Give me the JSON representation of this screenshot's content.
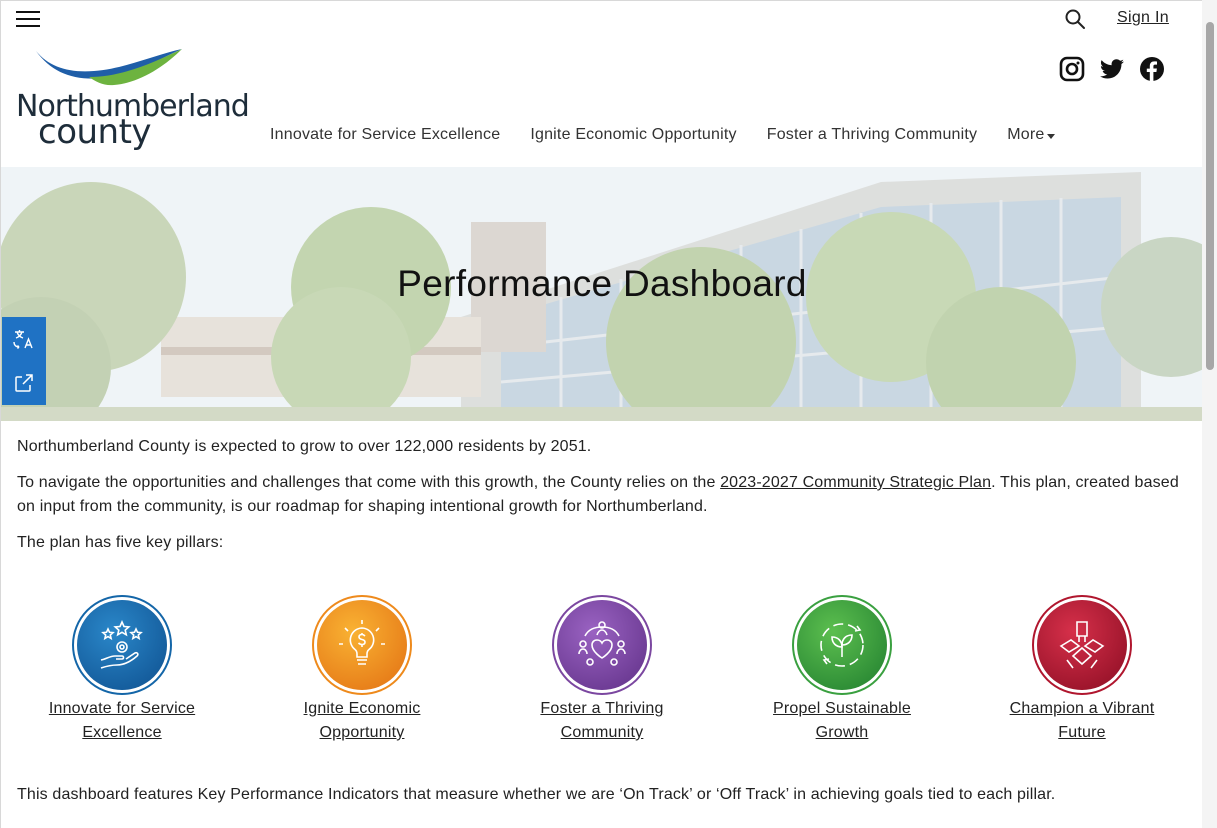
{
  "header": {
    "sign_in": "Sign In",
    "logo_text_line1": "Northumberland",
    "logo_text_line2": "county",
    "nav": [
      {
        "label": "Innovate for Service Excellence"
      },
      {
        "label": "Ignite Economic Opportunity"
      },
      {
        "label": "Foster a Thriving Community"
      },
      {
        "label": "More"
      }
    ],
    "social": [
      "instagram-icon",
      "twitter-icon",
      "facebook-icon"
    ]
  },
  "hero": {
    "title": "Performance Dashboard"
  },
  "sidetools": [
    "translate-icon",
    "share-icon"
  ],
  "content": {
    "p1": "Northumberland County is expected to grow to over 122,000 residents by 2051.",
    "p2_before": "To navigate the opportunities and challenges that come with this growth, the County relies on the ",
    "p2_link": "2023-2027 Community Strategic Plan",
    "p2_after": ". This plan, created based on input from the community, is our roadmap for shaping intentional growth for Northumberland.",
    "p3": "The plan has five key pillars:",
    "footer": "This dashboard features Key Performance Indicators that measure whether we are ‘On Track’ or ‘Off Track’ in achieving goals tied to each pillar."
  },
  "pillars": [
    {
      "label": "Innovate for Service Excellence",
      "icon": "stars-gear-hand-icon",
      "color": "#1466a8"
    },
    {
      "label": "Ignite Economic Opportunity",
      "icon": "lightbulb-dollar-icon",
      "color": "#ee8a1c"
    },
    {
      "label": "Foster a Thriving Community",
      "icon": "community-heart-icon",
      "color": "#7b47a0"
    },
    {
      "label": "Propel Sustainable Growth",
      "icon": "recycle-leaf-icon",
      "color": "#3aa040"
    },
    {
      "label": "Champion a Vibrant Future",
      "icon": "hands-together-icon",
      "color": "#b0162e"
    }
  ]
}
